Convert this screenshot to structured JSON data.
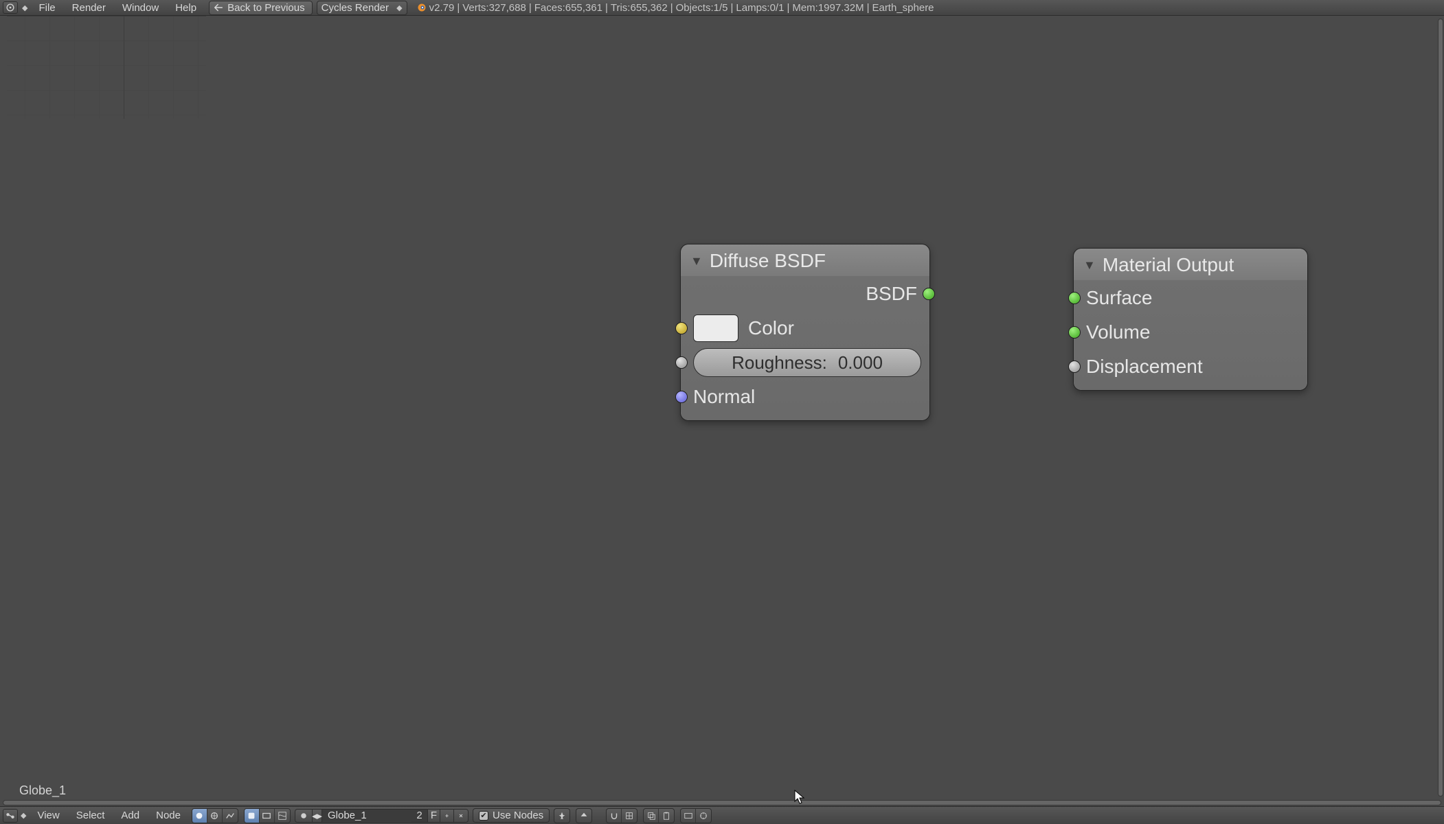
{
  "colors": {
    "accent": "#5e80b0",
    "socket_green": "#5fc63a",
    "socket_yellow": "#d9c13a",
    "socket_gray": "#aaaaaa",
    "socket_blue": "#7a7ae0"
  },
  "header": {
    "menus": {
      "file": "File",
      "render": "Render",
      "window": "Window",
      "help": "Help"
    },
    "back_button": "Back to Previous",
    "engine": "Cycles Render",
    "stats": {
      "version": "v2.79",
      "verts": "Verts:327,688",
      "faces": "Faces:655,361",
      "tris": "Tris:655,362",
      "objects": "Objects:1/5",
      "lamps": "Lamps:0/1",
      "mem": "Mem:1997.32M",
      "scene_name": "Earth_sphere"
    }
  },
  "node_editor": {
    "material_name": "Globe_1"
  },
  "nodes": {
    "diffuse": {
      "title": "Diffuse BSDF",
      "outputs": {
        "bsdf": "BSDF"
      },
      "inputs": {
        "color_label": "Color",
        "color_value": "#ececec",
        "roughness_label": "Roughness:",
        "roughness_value": "0.000",
        "normal_label": "Normal"
      }
    },
    "material_output": {
      "title": "Material Output",
      "inputs": {
        "surface": "Surface",
        "volume": "Volume",
        "displacement": "Displacement"
      }
    }
  },
  "footer": {
    "menus": {
      "view": "View",
      "select": "Select",
      "add": "Add",
      "node": "Node"
    },
    "material_name": "Globe_1",
    "user_count": "2",
    "fake_user": "F",
    "use_nodes": "Use Nodes"
  }
}
